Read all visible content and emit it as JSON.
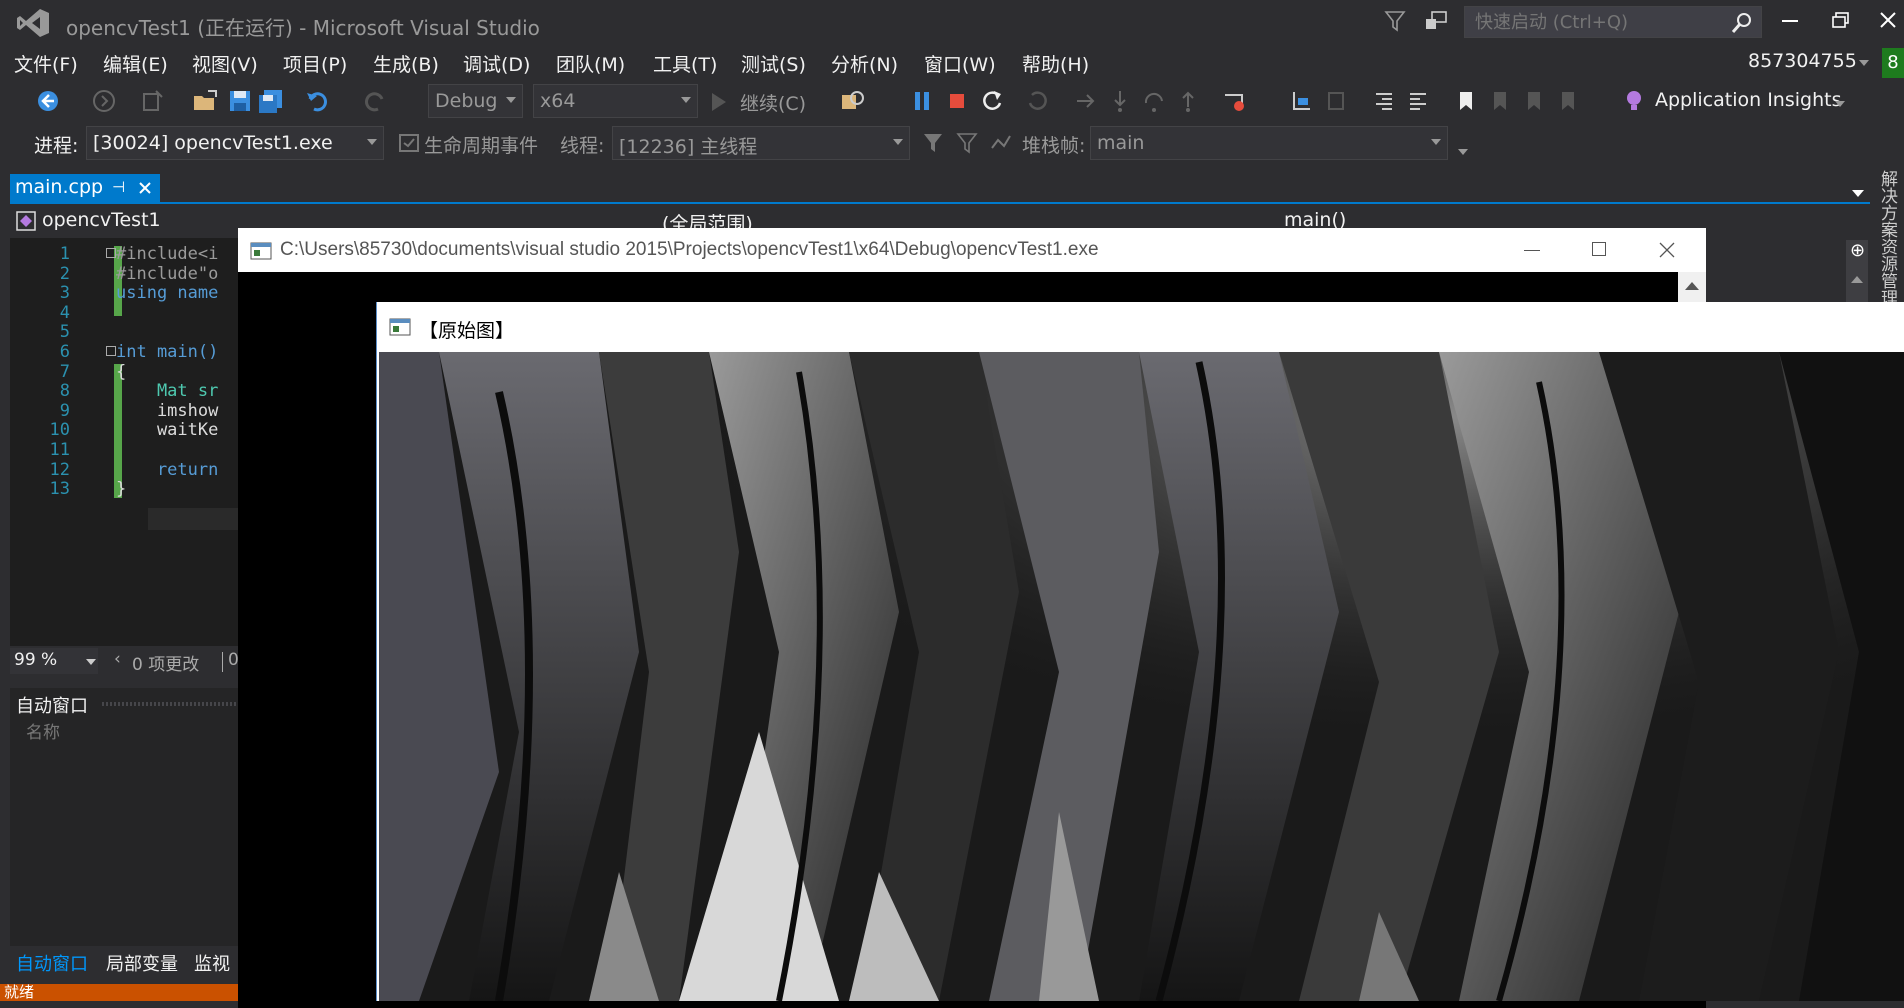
{
  "window": {
    "title": "opencvTest1 (正在运行) - Microsoft Visual Studio",
    "quick_launch_placeholder": "快速启动 (Ctrl+Q)",
    "user": "857304755",
    "notification_badge": "8"
  },
  "menu": [
    "文件(F)",
    "编辑(E)",
    "视图(V)",
    "项目(P)",
    "生成(B)",
    "调试(D)",
    "团队(M)",
    "工具(T)",
    "测试(S)",
    "分析(N)",
    "窗口(W)",
    "帮助(H)"
  ],
  "toolbar": {
    "config": "Debug",
    "platform": "x64",
    "continue": "继续(C)",
    "app_insights": "Application Insights"
  },
  "debug_bar": {
    "process_label": "进程:",
    "process_value": "[30024] opencvTest1.exe",
    "lifecycle": "生命周期事件",
    "thread_label": "线程:",
    "thread_value": "[12236] 主线程",
    "stack_label": "堆栈帧:",
    "stack_value": "main"
  },
  "editor": {
    "tab": "main.cpp",
    "nav_project": "opencvTest1",
    "nav_scope": "(全局范围)",
    "nav_func": "main()",
    "lines": [
      {
        "n": "1",
        "text": "#include<i"
      },
      {
        "n": "2",
        "text": "#include\"o"
      },
      {
        "n": "3",
        "text": "using name"
      },
      {
        "n": "4",
        "text": ""
      },
      {
        "n": "5",
        "text": ""
      },
      {
        "n": "6",
        "text": "int main()"
      },
      {
        "n": "7",
        "text": "{"
      },
      {
        "n": "8",
        "text": "    Mat sr"
      },
      {
        "n": "9",
        "text": "    imshow"
      },
      {
        "n": "10",
        "text": "    waitKe"
      },
      {
        "n": "11",
        "text": ""
      },
      {
        "n": "12",
        "text": "    return"
      },
      {
        "n": "13",
        "text": "}"
      }
    ],
    "zoom": "99 %",
    "changes": "0 项更改",
    "changes_tail": "0"
  },
  "auto_window": {
    "title": "自动窗口",
    "column": "名称",
    "tabs": [
      "自动窗口",
      "局部变量",
      "监视"
    ]
  },
  "status": "就绪",
  "console": {
    "title": "C:\\Users\\85730\\documents\\visual studio 2015\\Projects\\opencvTest1\\x64\\Debug\\opencvTest1.exe"
  },
  "image_window": {
    "title": "【原始图】"
  },
  "right_sidebar": "解决方案资源管理器",
  "colors": {
    "accent": "#007acc",
    "status": "#ca5100",
    "background": "#2d2d30"
  }
}
